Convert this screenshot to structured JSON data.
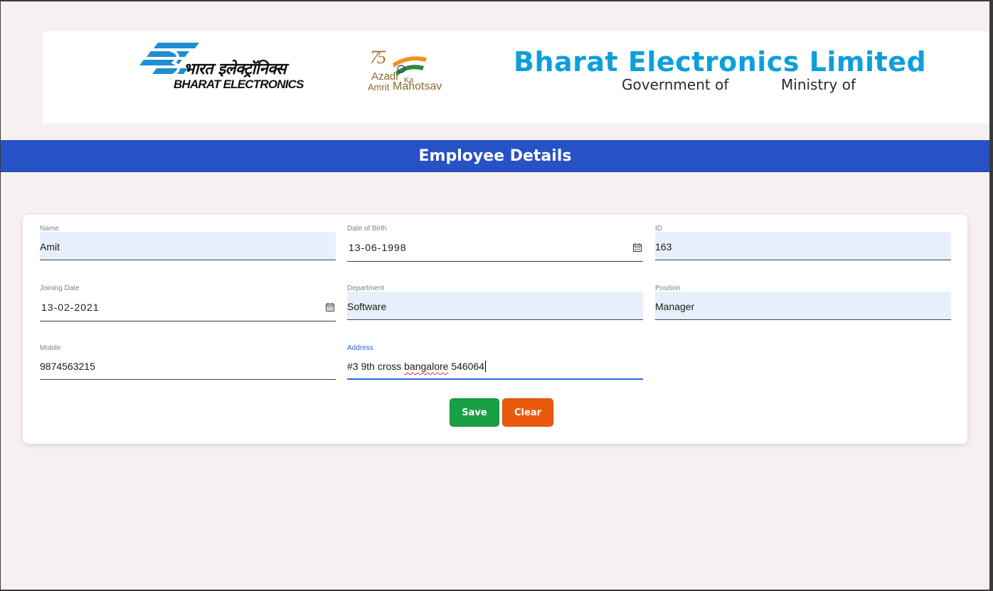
{
  "header": {
    "logo_hindi": "भारत इलेक्ट्रॉनिक्स",
    "logo_english": "BHARAT ELECTRONICS",
    "azadi_number": "75",
    "azadi_line1": "Azadi",
    "azadi_ka": "Ka",
    "azadi_line2a": "Amrit",
    "azadi_line2b": "Mahotsav",
    "company_name": "Bharat Electronics Limited",
    "government": "Government of",
    "ministry": "Ministry of"
  },
  "page_title": "Employee Details",
  "form": {
    "name": {
      "label": "Name",
      "value": "Amit"
    },
    "dob": {
      "label": "Date of Birth",
      "value": "13-06-1998"
    },
    "id": {
      "label": "ID",
      "value": "163"
    },
    "joining_date": {
      "label": "Joining Date",
      "value": "13-02-2021"
    },
    "department": {
      "label": "Department",
      "value": "Software"
    },
    "position": {
      "label": "Position",
      "value": "Manager"
    },
    "mobile": {
      "label": "Mobile",
      "value": "9874563215"
    },
    "address": {
      "label": "Address",
      "value_prefix": "#3 9th cross ",
      "value_misspelled": "bangalore",
      "value_suffix": " 546064"
    }
  },
  "buttons": {
    "save": "Save",
    "clear": "Clear"
  },
  "colors": {
    "title_bar": "#2652c5",
    "brand_blue": "#0c9fdc",
    "save": "#18a045",
    "clear": "#ea5a0c",
    "focus": "#2a6ae0"
  }
}
